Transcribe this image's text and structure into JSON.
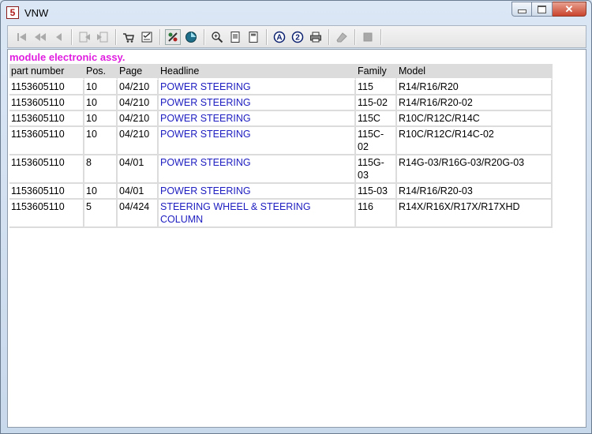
{
  "window": {
    "title": "VNW",
    "icon_letter": "5",
    "close_glyph": "✕"
  },
  "toolbar": {
    "icons": [
      "first-record-icon",
      "previous-page-icon",
      "previous-record-icon",
      "back-document-icon",
      "forward-document-icon",
      "cart-icon",
      "checklist-icon",
      "marker-tool-icon",
      "globe-icon",
      "zoom-in-icon",
      "page-view-icon",
      "page-fit-icon",
      "search-a-icon",
      "search-2-icon",
      "print-icon",
      "eraser-icon",
      "stop-icon"
    ]
  },
  "content": {
    "heading": "module electronic assy.",
    "headline_color": "#1c1cc0",
    "heading_color": "#e01ee0",
    "columns": [
      "part number",
      "Pos.",
      "Page",
      "Headline",
      "Family",
      "Model"
    ],
    "rows": [
      [
        "1153605110",
        "10",
        "04/210",
        "POWER STEERING",
        "115",
        "R14/R16/R20"
      ],
      [
        "1153605110",
        "10",
        "04/210",
        "POWER STEERING",
        "115-02",
        "R14/R16/R20-02"
      ],
      [
        "1153605110",
        "10",
        "04/210",
        "POWER STEERING",
        "115C",
        "R10C/R12C/R14C"
      ],
      [
        "1153605110",
        "10",
        "04/210",
        "POWER STEERING",
        "115C-02",
        "R10C/R12C/R14C-02"
      ],
      [
        "1153605110",
        "8",
        "04/01",
        "POWER STEERING",
        "115G-03",
        "R14G-03/R16G-03/R20G-03"
      ],
      [
        "1153605110",
        "10",
        "04/01",
        "POWER STEERING",
        "115-03",
        "R14/R16/R20-03"
      ],
      [
        "1153605110",
        "5",
        "04/424",
        "STEERING WHEEL & STEERING COLUMN",
        "116",
        "R14X/R16X/R17X/R17XHD"
      ]
    ]
  }
}
